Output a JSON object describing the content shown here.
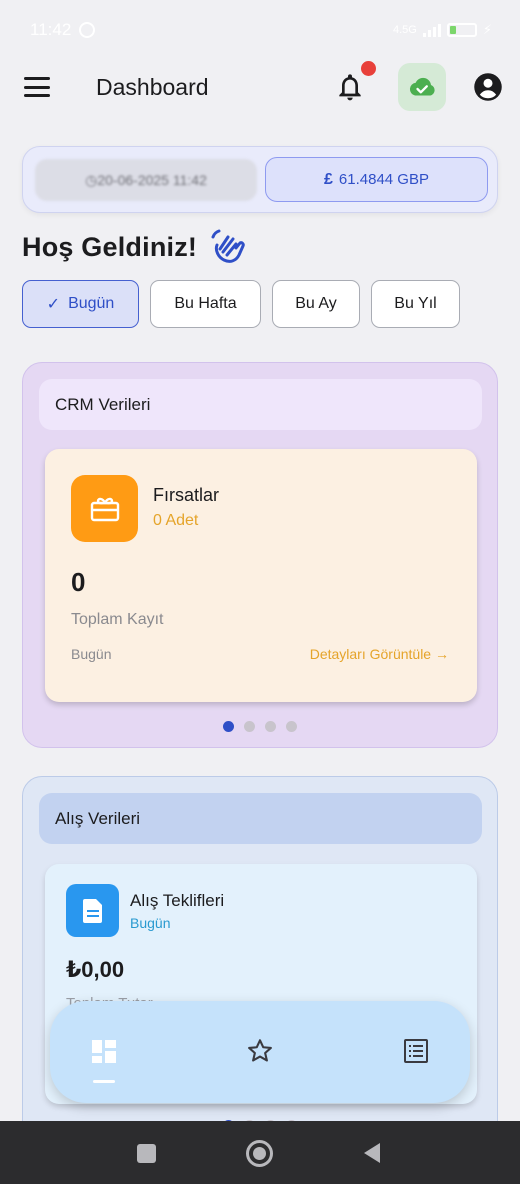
{
  "status_bar": {
    "time": "11:42",
    "network": "4.5G",
    "battery_level": "9"
  },
  "app_bar": {
    "title": "Dashboard",
    "icons": [
      "menu-icon",
      "bell-icon",
      "cloud-check-icon",
      "account-circle-icon"
    ]
  },
  "currency": {
    "time_text": "20-06-2025 11:42",
    "rate_symbol": "£",
    "rate_text": "61.4844 GBP"
  },
  "welcome": {
    "text": "Hoş Geldiniz!",
    "icon": "waving-hand-icon"
  },
  "filters": [
    {
      "label": "Bugün",
      "selected": true
    },
    {
      "label": "Bu Hafta",
      "selected": false
    },
    {
      "label": "Bu Ay",
      "selected": false
    },
    {
      "label": "Bu Yıl",
      "selected": false
    }
  ],
  "crm": {
    "header": "CRM Verileri",
    "card": {
      "title": "Fırsatlar",
      "count": "0 Adet",
      "total": "0",
      "total_label": "Toplam Kayıt",
      "period": "Bugün",
      "link": "Detayları Görüntüle →",
      "icon": "gift-card-icon"
    },
    "page_count": 4,
    "page_active": 1
  },
  "purchase": {
    "header": "Alış Verileri",
    "card": {
      "title": "Alış Teklifleri",
      "period": "Bugün",
      "amount": "₺0,00",
      "label": "Toplam Tutar",
      "icon": "document-icon"
    },
    "page_count": 4,
    "page_active": 1
  },
  "bottom_nav": {
    "items": [
      "dashboard-icon",
      "star-icon",
      "list-icon"
    ],
    "active": "dashboard-icon"
  },
  "colors": {
    "accent": "#2f4fc7",
    "crm_bg": "#e5d8f3",
    "opp_card_bg": "#fcf0e2",
    "opp_icon_bg": "#ff9b14",
    "purchase_bg": "#dfe7f5",
    "purchase_icon_bg": "#2997ef",
    "notification_dot": "#e8403a"
  }
}
